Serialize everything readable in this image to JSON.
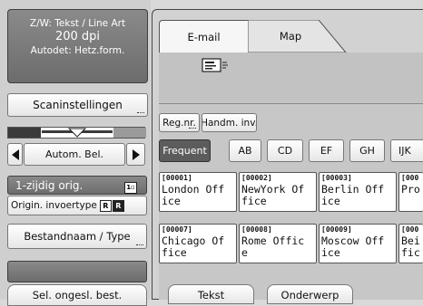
{
  "left": {
    "status": {
      "line1": "Z/W: Tekst / Line Art",
      "line2": "200 dpi",
      "line3": "Autodet: Hetz.form."
    },
    "scan_settings_label": "Scaninstellingen",
    "density": {
      "label": "Autom. Bel.",
      "level": 0.5
    },
    "orig_type_label": "1-zijdig orig.",
    "orig_input_label": "Origin. invoertype",
    "filename_label": "Bestandnaam / Type",
    "bottom_left_label": "Sel. ongesl. best."
  },
  "right": {
    "tabs": [
      {
        "label": "E-mail",
        "active": true
      },
      {
        "label": "Map",
        "active": false
      }
    ],
    "filter_buttons": [
      "Reg.nr.",
      "Handm. inv."
    ],
    "letter_tabs": [
      "Frequent",
      "AB",
      "CD",
      "EF",
      "GH",
      "IJK"
    ],
    "destinations": [
      {
        "num": "[00001]",
        "line1": "London Off",
        "line2": "ice"
      },
      {
        "num": "[00002]",
        "line1": "NewYork Of",
        "line2": "fice"
      },
      {
        "num": "[00003]",
        "line1": "Berlin Off",
        "line2": "ice"
      },
      {
        "num": "[000",
        "line1": "Pro",
        "line2": ""
      },
      {
        "num": "[00007]",
        "line1": "Chicago Of",
        "line2": "fice"
      },
      {
        "num": "[00008]",
        "line1": "Rome Offic",
        "line2": "e"
      },
      {
        "num": "[00009]",
        "line1": "Moscow Off",
        "line2": "ice"
      },
      {
        "num": "[000",
        "line1": "Bei",
        "line2": "fic"
      }
    ],
    "bottom_buttons": [
      "Tekst",
      "Onderwerp"
    ]
  },
  "icons": {
    "email_envelope": "envelope-icon",
    "arrow_left": "triangle-left",
    "arrow_right": "triangle-right"
  }
}
